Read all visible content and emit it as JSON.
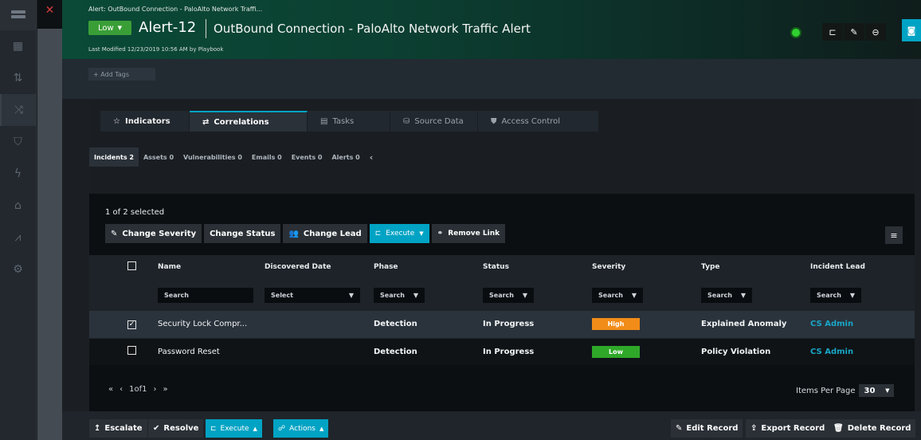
{
  "header": {
    "breadcrumb": "Alert: OutBound Connection - PaloAlto Network Traffi...",
    "severity": "Low",
    "record_id": "Alert-12",
    "title": "OutBound Connection - PaloAlto Network Traffic Alert",
    "last_modified": "Last Modified 12/23/2019 10:56 AM by Playbook"
  },
  "tags": {
    "add_label": "+ Add Tags"
  },
  "tabs": [
    {
      "label": "Indicators",
      "icon": "star-icon"
    },
    {
      "label": "Correlations",
      "icon": "swap-icon"
    },
    {
      "label": "Tasks",
      "icon": "list-icon"
    },
    {
      "label": "Source Data",
      "icon": "database-icon"
    },
    {
      "label": "Access Control",
      "icon": "shield-icon"
    }
  ],
  "subtabs": [
    "Incidents 2",
    "Assets 0",
    "Vulnerabilities 0",
    "Emails 0",
    "Events 0",
    "Alerts 0"
  ],
  "grid": {
    "selection_text": "1 of 2 selected",
    "actions": {
      "change_severity": "Change Severity",
      "change_status": "Change Status",
      "change_lead": "Change Lead",
      "execute": "Execute",
      "remove_link": "Remove Link"
    },
    "columns": [
      "Name",
      "Discovered Date",
      "Phase",
      "Status",
      "Severity",
      "Type",
      "Incident Lead"
    ],
    "filters": {
      "name_placeholder": "Search",
      "discovered": "Select",
      "search": "Search"
    },
    "rows": [
      {
        "checked": true,
        "name": "Security Lock Compr...",
        "discovered": "",
        "phase": "Detection",
        "status": "In Progress",
        "severity": "High",
        "type": "Explained Anomaly",
        "lead": "CS Admin"
      },
      {
        "checked": false,
        "name": "Password Reset",
        "discovered": "",
        "phase": "Detection",
        "status": "In Progress",
        "severity": "Low",
        "type": "Policy Violation",
        "lead": "CS Admin"
      }
    ],
    "pager": {
      "first": "«",
      "prev": "‹",
      "page": "1of1",
      "next": "›",
      "last": "»"
    },
    "items_per_page_label": "Items Per Page",
    "items_per_page": "30"
  },
  "footer": {
    "escalate": "Escalate",
    "resolve": "Resolve",
    "execute": "Execute",
    "actions": "Actions",
    "edit_record": "Edit Record",
    "export_record": "Export Record",
    "delete_record": "Delete Record"
  },
  "colors": {
    "accent": "#00a3c4",
    "severity_high": "#f28c18",
    "severity_low": "#2fa829",
    "lead_link": "#19a6c8"
  }
}
